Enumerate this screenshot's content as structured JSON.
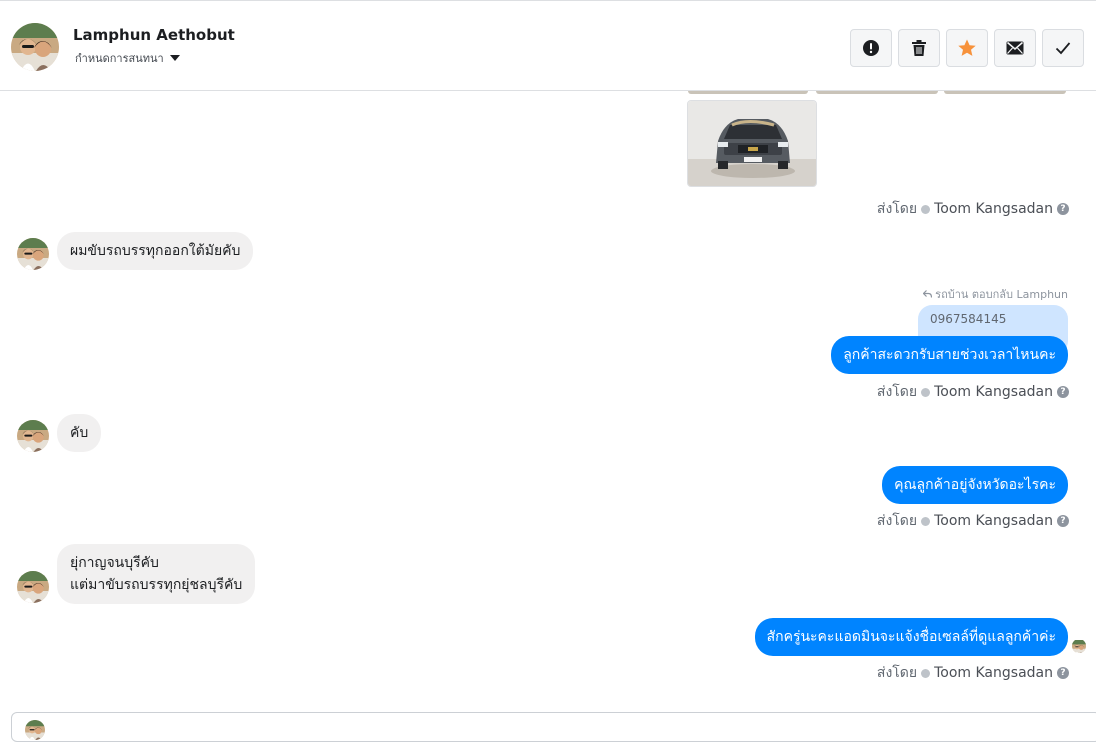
{
  "header": {
    "name": "Lamphun Aethobut",
    "assign_label": "กำหนดการสนทนา",
    "toolbar": [
      "spam-icon",
      "trash-icon",
      "star-icon",
      "mail-icon",
      "check-icon"
    ],
    "star_color": "#f7923b"
  },
  "thread": {
    "sent_by_label": "ส่งโดย",
    "agent_name": "Toom Kangsadan",
    "incoming": [
      {
        "text": "ผมขับรถบรรทุกออกใต้มัยคับ"
      },
      {
        "text": "คับ"
      },
      {
        "line1": "ยุ่กาญจนบุรีคับ",
        "line2": "แต่มาขับรถบรรทุกยุ่ชลบุรีคับ"
      }
    ],
    "reply": {
      "caption": "รถบ้าน ตอบกลับ Lamphun",
      "quoted": "0967584145"
    },
    "outgoing": [
      {
        "text": "ลูกค้าสะดวกรับสายช่วงเวลาไหนคะ"
      },
      {
        "text": "คุณลูกค้าอยู่จังหวัดอะไรคะ"
      },
      {
        "text": "สักครู่นะคะแอดมินจะแจ้งชื่อเซลล์ที่ดูแลลูกค้าค่ะ"
      }
    ]
  },
  "colors": {
    "outgoing_bubble": "#0084ff",
    "incoming_bubble": "#f1f0f0",
    "quoted_bubble": "#cfe5ff"
  }
}
